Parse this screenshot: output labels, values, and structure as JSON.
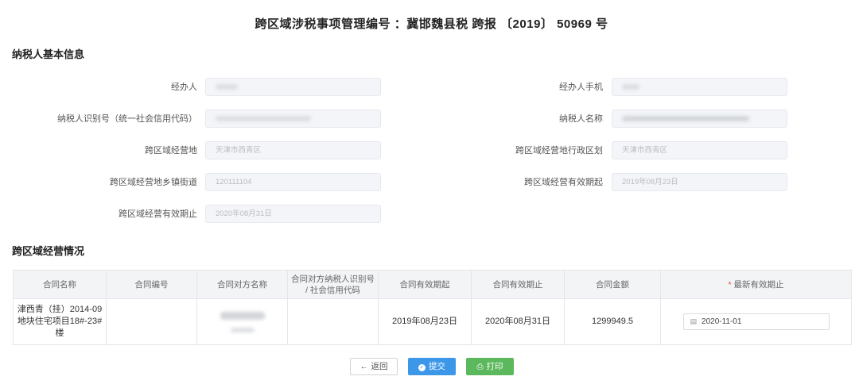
{
  "title": "跨区域涉税事项管理编号 ：冀邯魏县税 跨报 〔2019〕 50969 号",
  "sections": {
    "taxpayer_info": "纳税人基本信息",
    "business_info": "跨区域经营情况"
  },
  "form": {
    "handler_label": "经办人",
    "handler_phone_label": "经办人手机",
    "taxpayer_id_label": "纳税人识别号（统一社会信用代码）",
    "taxpayer_name_label": "纳税人名称",
    "business_location_label": "跨区域经营地",
    "business_location_value": "天津市西青区",
    "business_district_label": "跨区域经营地行政区划",
    "business_district_value": "天津市西青区",
    "street_label": "跨区域经营地乡镇街道",
    "street_value": "120111104",
    "valid_start_label": "跨区域经营有效期起",
    "valid_start_value": "2019年08月23日",
    "valid_end_label": "跨区域经营有效期止",
    "valid_end_value": "2020年08月31日"
  },
  "table": {
    "headers": {
      "contract_name": "合同名称",
      "contract_no": "合同编号",
      "counterparty_name": "合同对方名称",
      "counterparty_id": "合同对方纳税人识别号 / 社会信用代码",
      "contract_start": "合同有效期起",
      "contract_end": "合同有效期止",
      "contract_amount": "合同金额",
      "required_mark": "*",
      "latest_end": "最新有效期止"
    },
    "rows": [
      {
        "contract_name": "津西青（挂）2014-09地块住宅项目18#-23#楼",
        "contract_no": "",
        "counterparty_id": "",
        "contract_start": "2019年08月23日",
        "contract_end": "2020年08月31日",
        "contract_amount": "1299949.5",
        "latest_end": "2020-11-01"
      }
    ]
  },
  "buttons": {
    "back": "返回",
    "submit": "提交",
    "print": "打印"
  },
  "colors": {
    "primary": "#3d97e8",
    "success": "#5cb85c",
    "required": "#e0443c"
  }
}
